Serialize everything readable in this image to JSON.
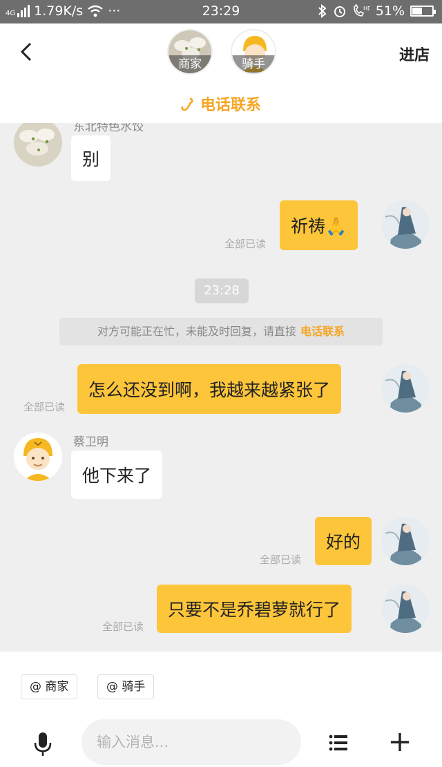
{
  "status_bar": {
    "network_label": "4G",
    "speed": "1.79K/s",
    "more": "···",
    "time": "23:29",
    "battery_text": "51%",
    "battery_level": 0.51
  },
  "header": {
    "merchant_label": "商家",
    "rider_label": "骑手",
    "enter_store": "进店",
    "phone_contact": "电话联系"
  },
  "messages": {
    "m0_name": "东北特色水饺",
    "m1_text": "别",
    "m2_text": "祈祷🙏",
    "m2_read": "全部已读",
    "time_sep": "23:28",
    "notice_text": "对方可能正在忙，未能及时回复，请直接",
    "notice_link": "电话联系",
    "m3_text": "怎么还没到啊，我越来越紧张了",
    "m3_read": "全部已读",
    "m4_name": "蔡卫明",
    "m4_text": "他下来了",
    "m5_text": "好的",
    "m5_read": "全部已读",
    "m6_text": "只要不是乔碧萝就行了",
    "m6_read": "全部已读"
  },
  "input_panel": {
    "at_merchant": "@ 商家",
    "at_rider": "@ 骑手",
    "placeholder": "输入消息..."
  },
  "colors": {
    "accent": "#f5a623",
    "outgoing_bubble": "#fdc53a",
    "incoming_bubble": "#ffffff",
    "background": "#efefef",
    "status_bar": "#6e6e6e"
  },
  "icons": [
    "signal-icon",
    "wifi-icon",
    "bluetooth-icon",
    "alarm-icon",
    "hd-call-icon",
    "battery-icon",
    "back-icon",
    "phone-icon",
    "mic-icon",
    "list-icon",
    "plus-icon"
  ]
}
